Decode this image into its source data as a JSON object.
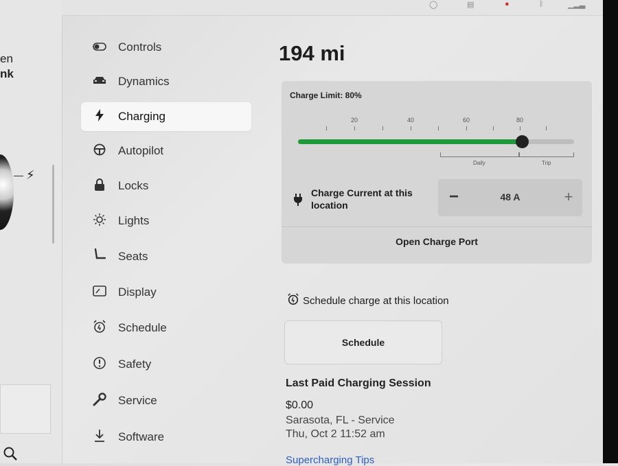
{
  "left_panel": {
    "line1": "en",
    "line2": "nk"
  },
  "nav": {
    "items": [
      {
        "label": "Controls",
        "icon": "toggle-icon"
      },
      {
        "label": "Dynamics",
        "icon": "car-icon"
      },
      {
        "label": "Charging",
        "icon": "bolt-icon",
        "active": true
      },
      {
        "label": "Autopilot",
        "icon": "steering-wheel-icon"
      },
      {
        "label": "Locks",
        "icon": "lock-icon"
      },
      {
        "label": "Lights",
        "icon": "light-icon"
      },
      {
        "label": "Seats",
        "icon": "seat-icon"
      },
      {
        "label": "Display",
        "icon": "display-icon"
      },
      {
        "label": "Schedule",
        "icon": "alarm-clock-icon"
      },
      {
        "label": "Safety",
        "icon": "alert-icon"
      },
      {
        "label": "Service",
        "icon": "wrench-icon"
      },
      {
        "label": "Software",
        "icon": "download-icon"
      }
    ]
  },
  "range": "194 mi",
  "charge_limit": {
    "title": "Charge Limit: 80%",
    "value_percent": 80,
    "tick_labels": [
      "20",
      "40",
      "60",
      "80"
    ],
    "range_labels": {
      "daily": "Daily",
      "trip": "Trip"
    },
    "fill_color": "#1e9a3a"
  },
  "charge_current": {
    "label": "Charge Current at this location",
    "value": "48 A",
    "minus": "−",
    "plus": "+"
  },
  "open_charge_port": "Open Charge Port",
  "schedule": {
    "heading": "Schedule charge at this location",
    "button": "Schedule"
  },
  "last_session": {
    "title": "Last Paid Charging Session",
    "amount": "$0.00",
    "location": "Sarasota, FL - Service",
    "time": "Thu, Oct 2 11:52 am"
  },
  "tips_link": "Supercharging Tips"
}
